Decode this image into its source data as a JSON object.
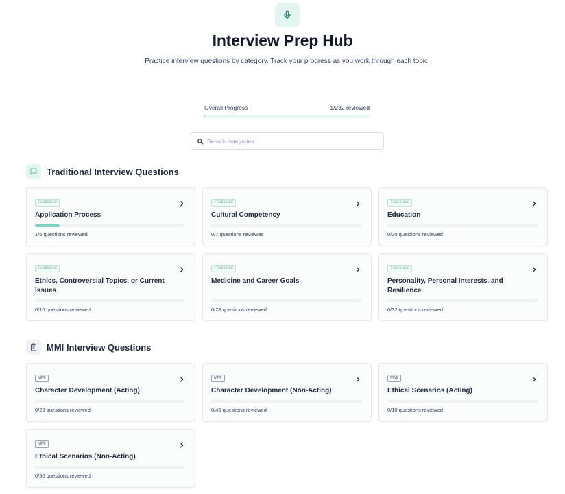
{
  "header": {
    "icon": "microphone-icon",
    "title": "Interview Prep Hub",
    "subtitle": "Practice interview questions by category. Track your progress as you work through each topic."
  },
  "progress": {
    "label": "Overall Progress",
    "text": "1/232 reviewed",
    "reviewed": 1,
    "total": 232,
    "fill_color": "#7dd3c0"
  },
  "search": {
    "icon": "search-icon",
    "placeholder": "Search categories..."
  },
  "colors": {
    "accent": "#7dd3c0",
    "accent_light": "#e3f5f1",
    "text_primary": "#111827"
  },
  "sections": [
    {
      "title": "Traditional Interview Questions",
      "icon": "chat-bubble-icon",
      "cards": [
        {
          "badge": "Traditional",
          "title": "Application Process",
          "count_text": "1/6 questions reviewed",
          "reviewed": 1,
          "total": 6
        },
        {
          "badge": "Traditional",
          "title": "Cultural Competency",
          "count_text": "0/7 questions reviewed",
          "reviewed": 0,
          "total": 7
        },
        {
          "badge": "Traditional",
          "title": "Education",
          "count_text": "0/20 questions reviewed",
          "reviewed": 0,
          "total": 20
        },
        {
          "badge": "Traditional",
          "title": "Ethics, Controversial Topics, or Current Issues",
          "count_text": "0/10 questions reviewed",
          "reviewed": 0,
          "total": 10
        },
        {
          "badge": "Traditional",
          "title": "Medicine and Career Goals",
          "count_text": "0/28 questions reviewed",
          "reviewed": 0,
          "total": 28
        },
        {
          "badge": "Traditional",
          "title": "Personality, Personal Interests, and Resilience",
          "count_text": "0/32 questions reviewed",
          "reviewed": 0,
          "total": 32
        }
      ]
    },
    {
      "title": "MMI Interview Questions",
      "icon": "clipboard-icon",
      "cards": [
        {
          "badge": "MMI",
          "title": "Character Development (Acting)",
          "count_text": "0/23 questions reviewed",
          "reviewed": 0,
          "total": 23
        },
        {
          "badge": "MMI",
          "title": "Character Development (Non-Acting)",
          "count_text": "0/46 questions reviewed",
          "reviewed": 0,
          "total": 46
        },
        {
          "badge": "MMI",
          "title": "Ethical Scenarios (Acting)",
          "count_text": "0/10 questions reviewed",
          "reviewed": 0,
          "total": 10
        },
        {
          "badge": "MMI",
          "title": "Ethical Scenarios (Non-Acting)",
          "count_text": "0/50 questions reviewed",
          "reviewed": 0,
          "total": 50
        }
      ]
    }
  ]
}
